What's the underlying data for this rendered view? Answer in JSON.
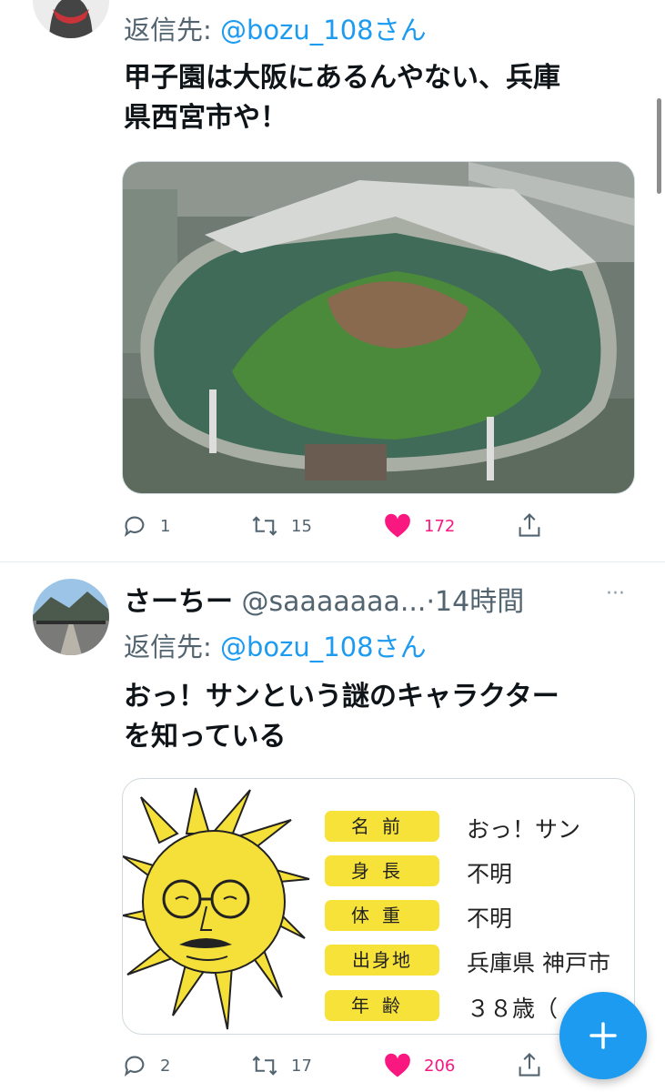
{
  "tweet1": {
    "reply_prefix": "返信先:",
    "reply_handle": "@bozu_108さん",
    "text_line1": "甲子園は大阪にあるんやない、兵庫",
    "text_line2": "県西宮市や！",
    "replies": "1",
    "retweets": "15",
    "likes": "172"
  },
  "tweet2": {
    "name": "さーちー",
    "handle": "@saaaaaaa...",
    "time": "·14時間",
    "more": "···",
    "reply_prefix": "返信先:",
    "reply_handle": "@bozu_108さん",
    "text_line1": "おっ！サンという謎のキャラクター",
    "text_line2": "を知っている",
    "replies": "2",
    "retweets": "17",
    "likes": "206",
    "profile_card": [
      {
        "label": "名前",
        "value": "おっ！サン"
      },
      {
        "label": "身長",
        "value": "不明"
      },
      {
        "label": "体重",
        "value": "不明"
      },
      {
        "label": "出身地",
        "value": "兵庫県 神戸市"
      },
      {
        "label": "年齢",
        "value": "３８歳（"
      }
    ]
  },
  "colors": {
    "accent": "#1d9bf0",
    "like": "#f91880",
    "muted": "#536471",
    "card_yellow": "#f7e23a"
  },
  "icons": [
    "reply-icon",
    "retweet-icon",
    "heart-filled-icon",
    "share-icon",
    "plus-icon"
  ]
}
